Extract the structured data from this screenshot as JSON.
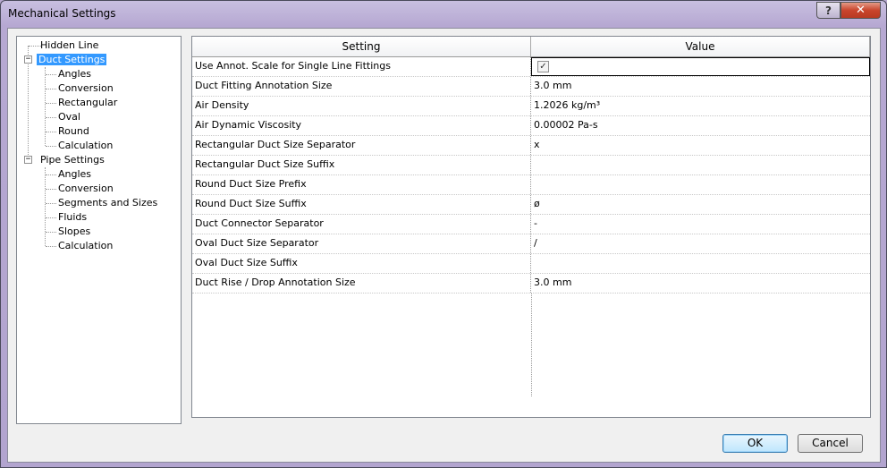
{
  "window": {
    "title": "Mechanical Settings",
    "help_label": "?",
    "close_label": "✕"
  },
  "tree": {
    "items": [
      {
        "label": "Hidden Line"
      },
      {
        "label": "Duct Settings",
        "expander": "−"
      },
      {
        "label": "Angles"
      },
      {
        "label": "Conversion"
      },
      {
        "label": "Rectangular"
      },
      {
        "label": "Oval"
      },
      {
        "label": "Round"
      },
      {
        "label": "Calculation"
      },
      {
        "label": "Pipe Settings",
        "expander": "−"
      },
      {
        "label": "Angles"
      },
      {
        "label": "Conversion"
      },
      {
        "label": "Segments and Sizes"
      },
      {
        "label": "Fluids"
      },
      {
        "label": "Slopes"
      },
      {
        "label": "Calculation"
      }
    ],
    "selected": "Duct Settings"
  },
  "grid": {
    "headers": [
      "Setting",
      "Value"
    ],
    "rows": [
      {
        "setting": "Use Annot. Scale for Single Line Fittings",
        "value": "",
        "checked": "✓"
      },
      {
        "setting": "Duct Fitting Annotation Size",
        "value": "3.0 mm"
      },
      {
        "setting": "Air Density",
        "value": "1.2026 kg/m³"
      },
      {
        "setting": "Air Dynamic Viscosity",
        "value": "0.00002 Pa-s"
      },
      {
        "setting": "Rectangular Duct Size Separator",
        "value": "x"
      },
      {
        "setting": "Rectangular Duct Size Suffix",
        "value": ""
      },
      {
        "setting": "Round Duct Size Prefix",
        "value": ""
      },
      {
        "setting": "Round Duct Size Suffix",
        "value": "ø"
      },
      {
        "setting": "Duct Connector Separator",
        "value": "-"
      },
      {
        "setting": "Oval Duct Size Separator",
        "value": "/"
      },
      {
        "setting": "Oval Duct Size Suffix",
        "value": ""
      },
      {
        "setting": "Duct Rise / Drop Annotation Size",
        "value": "3.0 mm"
      }
    ]
  },
  "buttons": {
    "ok_label": "OK",
    "cancel_label": "Cancel"
  }
}
